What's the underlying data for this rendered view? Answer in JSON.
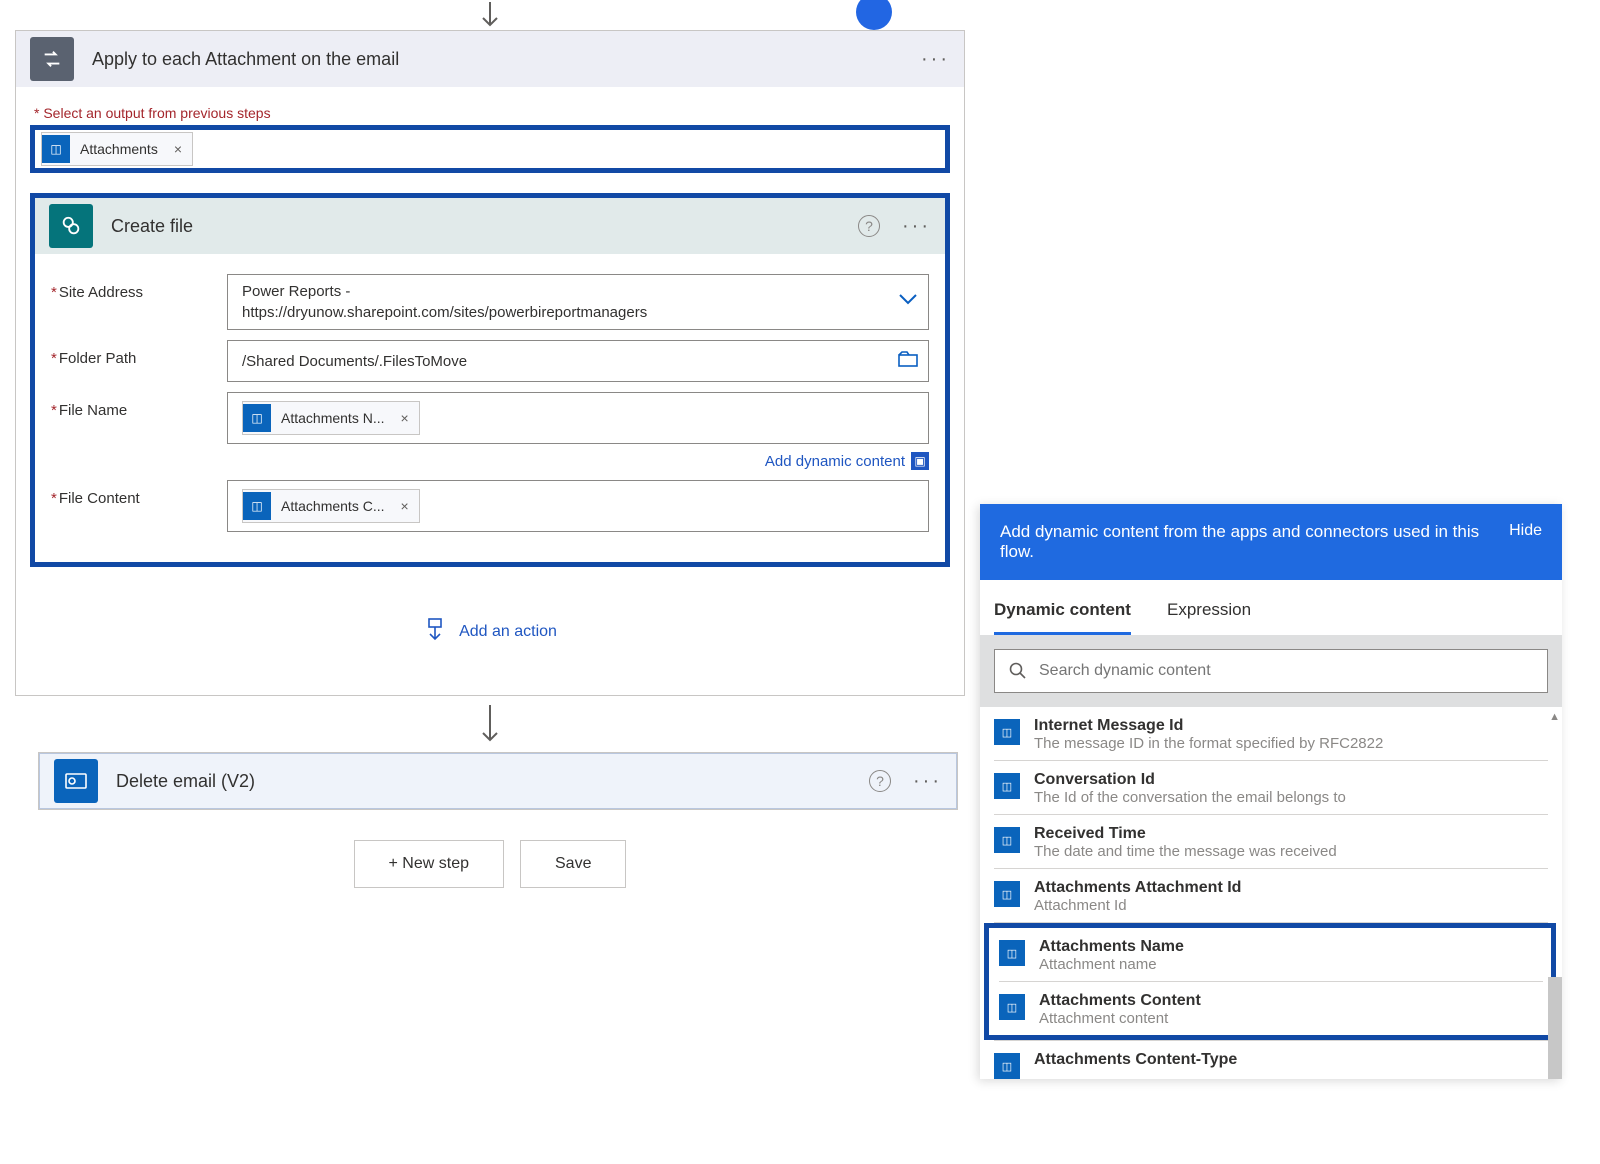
{
  "applyCard": {
    "title": "Apply to each Attachment on the email",
    "selectLabel": "* Select an output from previous steps",
    "attachmentsToken": "Attachments"
  },
  "createFile": {
    "title": "Create file",
    "labels": {
      "site": "Site Address",
      "folder": "Folder Path",
      "fileName": "File Name",
      "fileContent": "File Content"
    },
    "siteLine1": "Power Reports -",
    "siteLine2": "https://dryunow.sharepoint.com/sites/powerbireportmanagers",
    "folderPath": "/Shared Documents/.FilesToMove",
    "fileNameToken": "Attachments N...",
    "fileContentToken": "Attachments C...",
    "addDynamic": "Add dynamic content"
  },
  "addAction": "Add an action",
  "deleteEmail": {
    "title": "Delete email (V2)"
  },
  "buttons": {
    "newStep": "+ New step",
    "save": "Save"
  },
  "dyn": {
    "headerText": "Add dynamic content from the apps and connectors used in this flow.",
    "hide": "Hide",
    "tabs": {
      "dynamic": "Dynamic content",
      "expr": "Expression"
    },
    "searchPlaceholder": "Search dynamic content",
    "items": [
      {
        "title": "Internet Message Id",
        "desc": "The message ID in the format specified by RFC2822"
      },
      {
        "title": "Conversation Id",
        "desc": "The Id of the conversation the email belongs to"
      },
      {
        "title": "Received Time",
        "desc": "The date and time the message was received"
      },
      {
        "title": "Attachments Attachment Id",
        "desc": "Attachment Id"
      },
      {
        "title": "Attachments Name",
        "desc": "Attachment name"
      },
      {
        "title": "Attachments Content",
        "desc": "Attachment content"
      },
      {
        "title": "Attachments Content-Type",
        "desc": ""
      }
    ]
  }
}
